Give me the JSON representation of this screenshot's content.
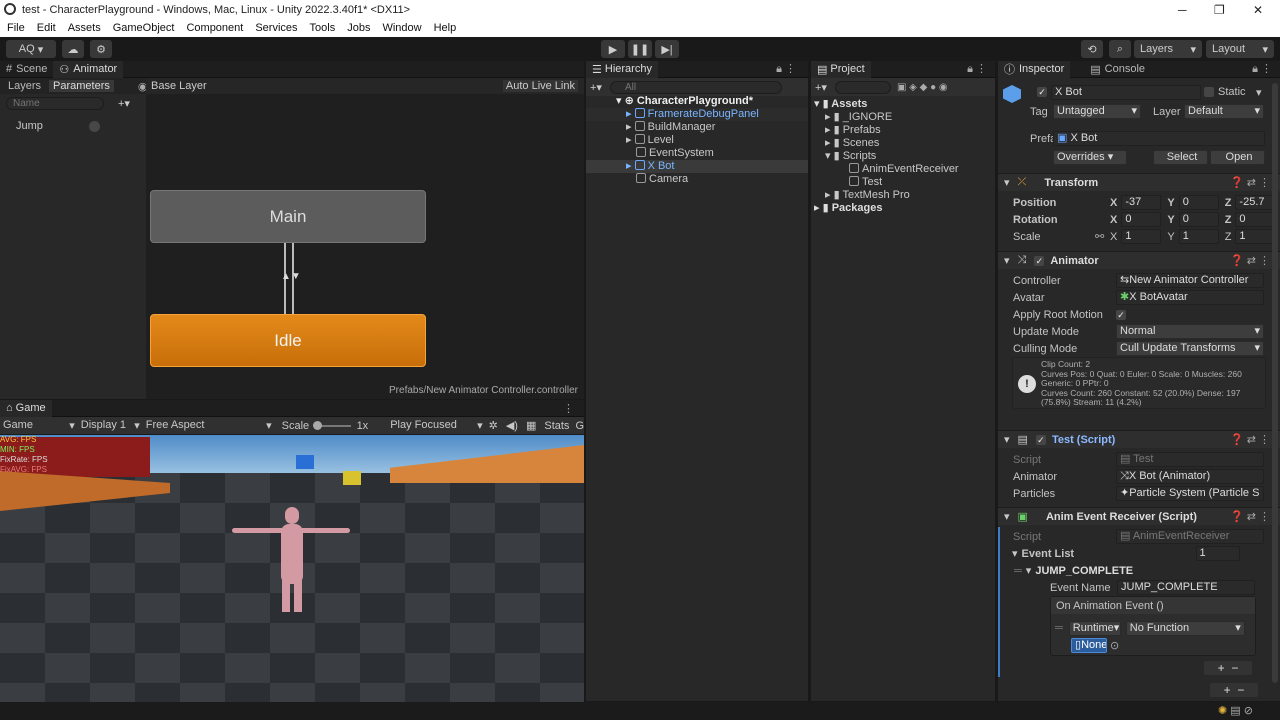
{
  "window": {
    "title": "test - CharacterPlayground - Windows, Mac, Linux - Unity 2022.3.40f1* <DX11>"
  },
  "menu": [
    "File",
    "Edit",
    "Assets",
    "GameObject",
    "Component",
    "Services",
    "Tools",
    "Jobs",
    "Window",
    "Help"
  ],
  "toolbar": {
    "account": "AQ",
    "layers": "Layers",
    "layout": "Layout"
  },
  "animator": {
    "tabs": {
      "scene": "Scene",
      "animator": "Animator"
    },
    "subtabs": {
      "layers": "Layers",
      "parameters": "Parameters"
    },
    "search_placeholder": "Name",
    "param": "Jump",
    "base_layer": "Base Layer",
    "auto_live_link": "Auto Live Link",
    "state_main": "Main",
    "state_idle": "Idle",
    "footer": "Prefabs/New Animator Controller.controller"
  },
  "game": {
    "tab": "Game",
    "mode": "Game",
    "display": "Display 1",
    "aspect": "Free Aspect",
    "scale_label": "Scale",
    "scale_value": "1x",
    "play_focused": "Play Focused",
    "stats": "Stats",
    "gizmos": "G",
    "overlay": [
      "AVG: FPS",
      "MIN: FPS",
      "FixRate: FPS",
      "FixAVG: FPS"
    ]
  },
  "hierarchy": {
    "tab": "Hierarchy",
    "search_placeholder": "All",
    "scene": "CharacterPlayground*",
    "items": [
      "FramerateDebugPanel",
      "BuildManager",
      "Level",
      "EventSystem",
      "X Bot",
      "Camera"
    ]
  },
  "project": {
    "tab": "Project",
    "assets": "Assets",
    "folders": [
      "_IGNORE",
      "Prefabs",
      "Scenes",
      "Scripts"
    ],
    "scripts": [
      "AnimEventReceiver",
      "Test"
    ],
    "textmesh": "TextMesh Pro",
    "packages": "Packages"
  },
  "inspector": {
    "tab": "Inspector",
    "console_tab": "Console",
    "object_name": "X Bot",
    "static": "Static",
    "tag_label": "Tag",
    "tag": "Untagged",
    "layer_label": "Layer",
    "layer": "Default",
    "prefab_label": "Prefab",
    "prefab": "X Bot",
    "overrides": "Overrides",
    "select": "Select",
    "open": "Open",
    "transform": {
      "title": "Transform",
      "position": "Position",
      "rotation": "Rotation",
      "scale": "Scale",
      "pos": [
        "-37",
        "0",
        "-25.7"
      ],
      "rot": [
        "0",
        "0",
        "0"
      ],
      "scl": [
        "1",
        "1",
        "1"
      ]
    },
    "animator": {
      "title": "Animator",
      "controller_label": "Controller",
      "controller": "New Animator Controller",
      "avatar_label": "Avatar",
      "avatar": "X BotAvatar",
      "root_motion_label": "Apply Root Motion",
      "update_label": "Update Mode",
      "update": "Normal",
      "culling_label": "Culling Mode",
      "culling": "Cull Update Transforms",
      "info": [
        "Clip Count: 2",
        "Curves Pos: 0 Quat: 0 Euler: 0 Scale: 0 Muscles: 260",
        "Generic: 0 PPtr: 0",
        "Curves Count: 260 Constant: 52 (20.0%) Dense: 197",
        "(75.8%) Stream: 11 (4.2%)"
      ]
    },
    "test": {
      "title": "Test (Script)",
      "script_label": "Script",
      "script": "Test",
      "animator_label": "Animator",
      "animator": "X Bot (Animator)",
      "particles_label": "Particles",
      "particles": "Particle System (Particle S"
    },
    "receiver": {
      "title": "Anim Event Receiver (Script)",
      "script_label": "Script",
      "script": "AnimEventReceiver",
      "event_list": "Event List",
      "event_count": "1",
      "element": "JUMP_COMPLETE",
      "event_name_label": "Event Name",
      "event_name": "JUMP_COMPLETE",
      "on_event": "On Animation Event ()",
      "runtime": "Runtime",
      "function": "No Function",
      "target": "None"
    }
  }
}
